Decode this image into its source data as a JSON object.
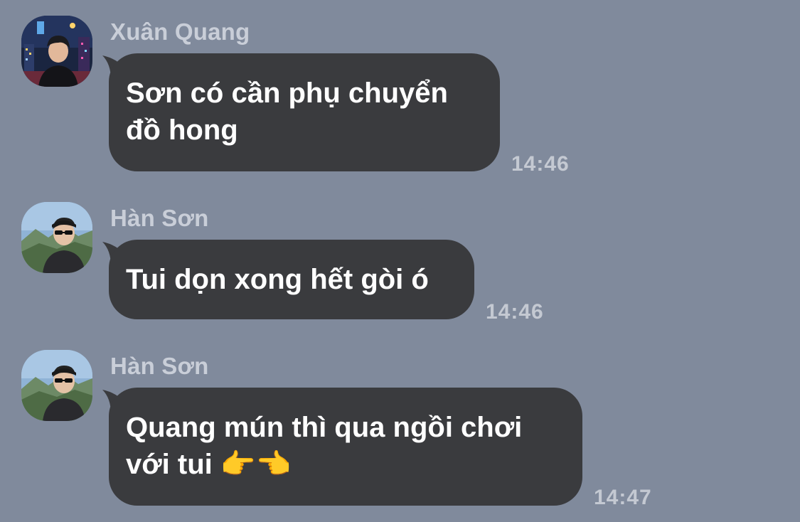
{
  "messages": [
    {
      "sender": "Xuân Quang",
      "text_line1": "Sơn có cần phụ chuyển",
      "text_line2": "đồ hong",
      "time": "14:46",
      "avatar": "avatar-night-city-photo"
    },
    {
      "sender": "Hàn Sơn",
      "text_line1": "Tui dọn xong hết gòi ó",
      "time": "14:46",
      "avatar": "avatar-mountain-photo"
    },
    {
      "sender": "Hàn Sơn",
      "text_line1": "Quang mún thì qua ngồi chơi",
      "text_line2": "với tui",
      "emoji": "👉👈",
      "time": "14:47",
      "avatar": "avatar-mountain-photo"
    }
  ],
  "colors": {
    "background": "#808a9c",
    "bubble": "#3a3b3e",
    "sender_text": "#c9ced8",
    "time_text": "#c4c9d2"
  }
}
